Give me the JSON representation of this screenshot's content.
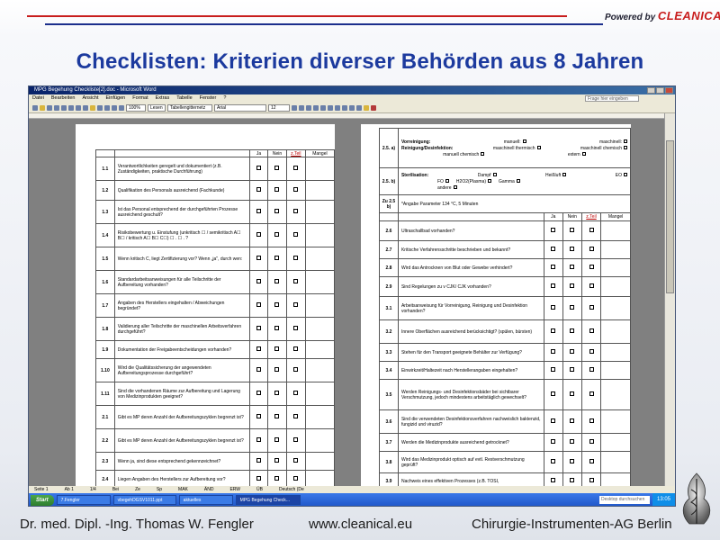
{
  "slide": {
    "title": "Checklisten: Kriterien diverser Behörden aus 8 Jahren",
    "powered_by": "Powered by",
    "brand": "CLEANICAL",
    "footer_author": "Dr. med. Dipl. -Ing. Thomas W. Fengler",
    "footer_url": "www.cleanical.eu",
    "footer_company": "Chirurgie-Instrumenten-AG Berlin"
  },
  "window": {
    "title": "MPG Begehung Checkliste[2].doc - Microsoft Word",
    "menu": [
      "Datei",
      "Bearbeiten",
      "Ansicht",
      "Einfügen",
      "Format",
      "Extras",
      "Tabelle",
      "Fenster",
      "?"
    ],
    "help_placeholder": "Frage hier eingeben",
    "zoom": "100%",
    "read_mode": "Lesen",
    "style_combo": "Tabellengitternetz",
    "font_combo": "Arial",
    "size_combo": "12",
    "status": [
      "Seite 1",
      "Ab 1",
      "1/4",
      "Bei",
      "Ze",
      "Sp",
      "MAK",
      "ÄND",
      "ERW",
      "ÜB",
      "Deutsch (De"
    ]
  },
  "taskbar": {
    "start": "Start",
    "items": [
      "7.Fengler",
      "vbegehDGSV1011.ppt",
      "aktuelles",
      "MPG Begehung Check..."
    ],
    "search_placeholder": "Desktop durchsuchen",
    "clock": "13:05"
  },
  "checklist": {
    "headers": [
      "Ja",
      "Nein",
      "z.Teil",
      "Mangel"
    ],
    "left_rows": [
      {
        "num": "1.1",
        "text": "Verantwortlichkeiten geregelt und dokumentiert (z.B. Zuständigkeiten, praktische Durchführung)"
      },
      {
        "num": "1.2",
        "text": "Qualifikation des Personals ausreichend (Fachkunde)"
      },
      {
        "num": "1.3",
        "text": "Ist das Personal entsprechend der durchgeführten Prozesse ausreichend geschult?"
      },
      {
        "num": "1.4",
        "text": "Risikobewertung u. Einstufung (unkritisch ☐ / semikritisch A☐ B☐ / kritisch A☐ B☐ C☐) ☐ . ☐ . ?"
      },
      {
        "num": "1.5",
        "text": "Wenn kritisch C, liegt Zertifizierung vor? Wenn „ja\", durch wen:"
      },
      {
        "num": "1.6",
        "text": "Standardarbeitsanweisungen für alle Teilschritte der Aufbereitung vorhanden?"
      },
      {
        "num": "1.7",
        "text": "Angaben des Herstellers eingehalten / Abweichungen begründet?"
      },
      {
        "num": "1.8",
        "text": "Validierung aller Teilschritte der maschinellen Arbeitsverfahren durchgeführt?"
      },
      {
        "num": "1.9",
        "text": "Dokumentation der Freigabeentscheidungen vorhanden?"
      },
      {
        "num": "1.10",
        "text": "Wird die Qualitätssicherung der angewendeten Aufbereitungsprozesse durchgeführt?"
      },
      {
        "num": "1.11",
        "text": "Sind die vorhandenen Räume zur Aufbereitung und Lagerung von Medizinprodukten geeignet?"
      },
      {
        "num": "2.1",
        "text": "Gibt es MP deren Anzahl der Aufbereitungszyklen begrenzt ist?"
      },
      {
        "num": "2.2",
        "text": "Gibt es MP deren Anzahl der Aufbereitungszyklen begrenzt ist?"
      },
      {
        "num": "2.3",
        "text": "Wenn ja, sind diese entsprechend gekennzeichnet?"
      },
      {
        "num": "2.4",
        "text": "Liegen Angaben des Herstellers zur Aufbereitung vor?"
      }
    ],
    "right_top": {
      "row_a_num": "2.5. a)",
      "reinigung_label": "Vorreinigung:",
      "reinigung_opts": [
        "manuell:",
        "maschinell:"
      ],
      "desinfektion_label": "Reinigung/Desinfektion:",
      "desinfektion_opts": [
        "maschinell thermisch",
        "maschinell chemisch",
        "manuell chemisch",
        "extern"
      ],
      "row_b_num": "2.5. b)",
      "steril_label": "Sterilisation:",
      "steril_opts": [
        "Dampf",
        "Heißluft",
        "EO",
        "FO",
        "H2O2(Plasma)",
        "Gamma",
        "andere"
      ],
      "row_c_num": "Zu 2.5 b)",
      "row_c_text": "*Angabe Parameter 134 °C, 5 Minuten"
    },
    "right_rows": [
      {
        "num": "2.6",
        "text": "Ultraschallbad vorhanden?"
      },
      {
        "num": "2.7",
        "text": "Kritische Verfahrensschritte beschrieben und bekannt?"
      },
      {
        "num": "2.8",
        "text": "Wird das Antrocknen von Blut oder Gewebe verhindert?"
      },
      {
        "num": "2.9",
        "text": "Sind Regelungen zu v CJK/ CJK vorhanden?"
      },
      {
        "num": "3.1",
        "text": "Arbeitsanweisung für Vorreinigung, Reinigung und Desinfektion vorhanden?"
      },
      {
        "num": "3.2",
        "text": "Innere Oberflächen ausreichend berücksichtigt? (spülen, bürsten)"
      },
      {
        "num": "3.3",
        "text": "Stehen für den Transport geeignete Behälter zur Verfügung?"
      },
      {
        "num": "3.4",
        "text": "Einwirkzeit/Haltezeit nach Herstellerangaben eingehalten?"
      },
      {
        "num": "3.5",
        "text": "Werden Reinigungs- und Desinfektionsbäder bei sichtbarer Verschmutzung, jedoch mindestens arbeitstäglich gewechselt?"
      },
      {
        "num": "3.6",
        "text": "Sind die verwendeten Desinfektionsverfahren nachweislich baktenzid, fungizid und viruzid?"
      },
      {
        "num": "3.7",
        "text": "Werden die Medizinprodukte ausreichend getrocknet?"
      },
      {
        "num": "3.8",
        "text": "Wird das Medizinprodukt optisch auf evtl. Restverschmutzung geprüft?"
      },
      {
        "num": "3.9",
        "text": "Nachweis eines effektiven Prozesses (z.B. TOSI,"
      }
    ]
  }
}
